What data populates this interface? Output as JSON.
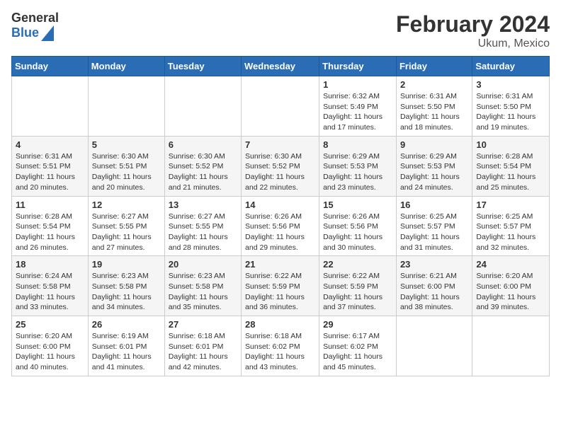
{
  "header": {
    "logo_general": "General",
    "logo_blue": "Blue",
    "title": "February 2024",
    "location": "Ukum, Mexico"
  },
  "days_of_week": [
    "Sunday",
    "Monday",
    "Tuesday",
    "Wednesday",
    "Thursday",
    "Friday",
    "Saturday"
  ],
  "weeks": [
    [
      {
        "day": "",
        "info": ""
      },
      {
        "day": "",
        "info": ""
      },
      {
        "day": "",
        "info": ""
      },
      {
        "day": "",
        "info": ""
      },
      {
        "day": "1",
        "info": "Sunrise: 6:32 AM\nSunset: 5:49 PM\nDaylight: 11 hours and 17 minutes."
      },
      {
        "day": "2",
        "info": "Sunrise: 6:31 AM\nSunset: 5:50 PM\nDaylight: 11 hours and 18 minutes."
      },
      {
        "day": "3",
        "info": "Sunrise: 6:31 AM\nSunset: 5:50 PM\nDaylight: 11 hours and 19 minutes."
      }
    ],
    [
      {
        "day": "4",
        "info": "Sunrise: 6:31 AM\nSunset: 5:51 PM\nDaylight: 11 hours and 20 minutes."
      },
      {
        "day": "5",
        "info": "Sunrise: 6:30 AM\nSunset: 5:51 PM\nDaylight: 11 hours and 20 minutes."
      },
      {
        "day": "6",
        "info": "Sunrise: 6:30 AM\nSunset: 5:52 PM\nDaylight: 11 hours and 21 minutes."
      },
      {
        "day": "7",
        "info": "Sunrise: 6:30 AM\nSunset: 5:52 PM\nDaylight: 11 hours and 22 minutes."
      },
      {
        "day": "8",
        "info": "Sunrise: 6:29 AM\nSunset: 5:53 PM\nDaylight: 11 hours and 23 minutes."
      },
      {
        "day": "9",
        "info": "Sunrise: 6:29 AM\nSunset: 5:53 PM\nDaylight: 11 hours and 24 minutes."
      },
      {
        "day": "10",
        "info": "Sunrise: 6:28 AM\nSunset: 5:54 PM\nDaylight: 11 hours and 25 minutes."
      }
    ],
    [
      {
        "day": "11",
        "info": "Sunrise: 6:28 AM\nSunset: 5:54 PM\nDaylight: 11 hours and 26 minutes."
      },
      {
        "day": "12",
        "info": "Sunrise: 6:27 AM\nSunset: 5:55 PM\nDaylight: 11 hours and 27 minutes."
      },
      {
        "day": "13",
        "info": "Sunrise: 6:27 AM\nSunset: 5:55 PM\nDaylight: 11 hours and 28 minutes."
      },
      {
        "day": "14",
        "info": "Sunrise: 6:26 AM\nSunset: 5:56 PM\nDaylight: 11 hours and 29 minutes."
      },
      {
        "day": "15",
        "info": "Sunrise: 6:26 AM\nSunset: 5:56 PM\nDaylight: 11 hours and 30 minutes."
      },
      {
        "day": "16",
        "info": "Sunrise: 6:25 AM\nSunset: 5:57 PM\nDaylight: 11 hours and 31 minutes."
      },
      {
        "day": "17",
        "info": "Sunrise: 6:25 AM\nSunset: 5:57 PM\nDaylight: 11 hours and 32 minutes."
      }
    ],
    [
      {
        "day": "18",
        "info": "Sunrise: 6:24 AM\nSunset: 5:58 PM\nDaylight: 11 hours and 33 minutes."
      },
      {
        "day": "19",
        "info": "Sunrise: 6:23 AM\nSunset: 5:58 PM\nDaylight: 11 hours and 34 minutes."
      },
      {
        "day": "20",
        "info": "Sunrise: 6:23 AM\nSunset: 5:58 PM\nDaylight: 11 hours and 35 minutes."
      },
      {
        "day": "21",
        "info": "Sunrise: 6:22 AM\nSunset: 5:59 PM\nDaylight: 11 hours and 36 minutes."
      },
      {
        "day": "22",
        "info": "Sunrise: 6:22 AM\nSunset: 5:59 PM\nDaylight: 11 hours and 37 minutes."
      },
      {
        "day": "23",
        "info": "Sunrise: 6:21 AM\nSunset: 6:00 PM\nDaylight: 11 hours and 38 minutes."
      },
      {
        "day": "24",
        "info": "Sunrise: 6:20 AM\nSunset: 6:00 PM\nDaylight: 11 hours and 39 minutes."
      }
    ],
    [
      {
        "day": "25",
        "info": "Sunrise: 6:20 AM\nSunset: 6:00 PM\nDaylight: 11 hours and 40 minutes."
      },
      {
        "day": "26",
        "info": "Sunrise: 6:19 AM\nSunset: 6:01 PM\nDaylight: 11 hours and 41 minutes."
      },
      {
        "day": "27",
        "info": "Sunrise: 6:18 AM\nSunset: 6:01 PM\nDaylight: 11 hours and 42 minutes."
      },
      {
        "day": "28",
        "info": "Sunrise: 6:18 AM\nSunset: 6:02 PM\nDaylight: 11 hours and 43 minutes."
      },
      {
        "day": "29",
        "info": "Sunrise: 6:17 AM\nSunset: 6:02 PM\nDaylight: 11 hours and 45 minutes."
      },
      {
        "day": "",
        "info": ""
      },
      {
        "day": "",
        "info": ""
      }
    ]
  ]
}
